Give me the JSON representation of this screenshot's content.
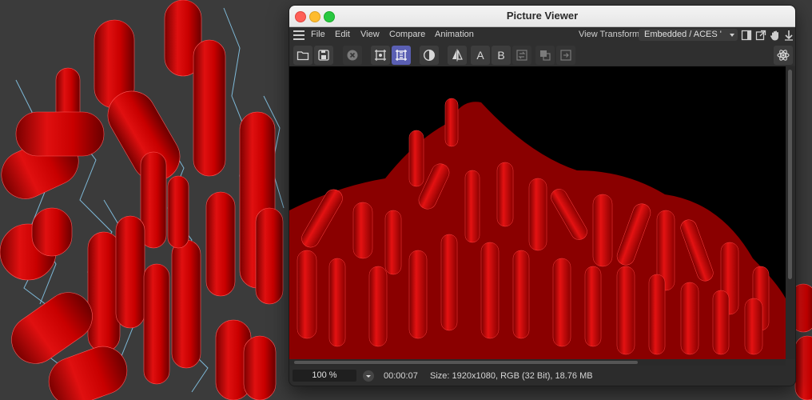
{
  "window": {
    "title": "Picture Viewer"
  },
  "menu": {
    "items": [
      "File",
      "Edit",
      "View",
      "Compare",
      "Animation"
    ],
    "view_transform_label": "View Transform",
    "view_transform_value": "Embedded / ACES '"
  },
  "toolbar": {
    "ab_a": "A",
    "ab_b": "B"
  },
  "status": {
    "zoom": "100 %",
    "timecode": "00:00:07",
    "info": "Size: 1920x1080, RGB (32 Bit), 18.76 MB"
  },
  "colors": {
    "viewport_bg": "#3b3b3b",
    "object_red": "#c40000",
    "spline_cyan": "#8fd8ff",
    "render_bg": "#000000",
    "active_tool": "#5a5fb3",
    "traffic_close": "#fe5f57",
    "traffic_min": "#febc2e",
    "traffic_max": "#28c840"
  }
}
